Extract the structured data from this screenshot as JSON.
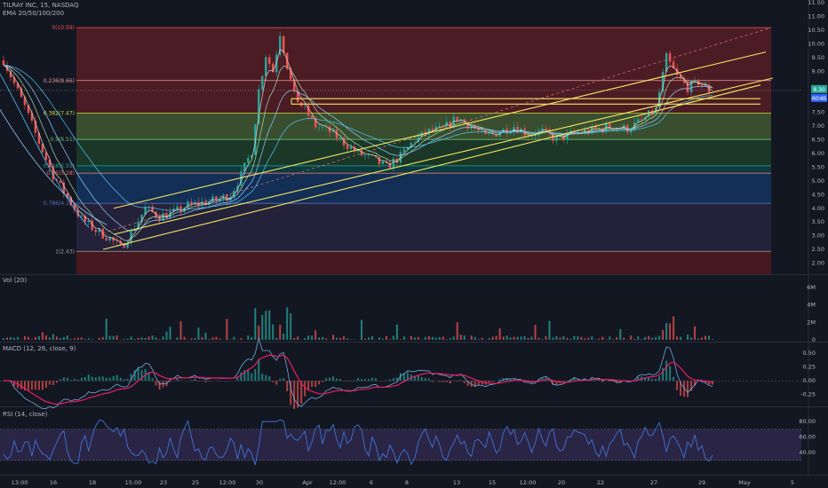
{
  "header": {
    "symbol": "TILRAY INC, 15, NASDAQ",
    "indicator": "EMA 20/50/100/200"
  },
  "panes": {
    "vol_label": "Vol (20)",
    "macd_label": "MACD (12, 26, close, 9)",
    "rsi_label": "RSI (14, close)"
  },
  "colors": {
    "background": "#131722",
    "candle_up": "#26a69a",
    "candle_down": "#ef5350",
    "channel": "#f5e663",
    "macd_line": "#6fa8dc",
    "signal_line": "#e91e63",
    "rsi_line": "#3f74d6",
    "rsi_band": "#7e57c2"
  },
  "chart_data": [
    {
      "type": "candlestick",
      "title": "TILRAY INC, 15, NASDAQ",
      "ylim": [
        1.5,
        11.5
      ],
      "y_ticks": [
        "11.50",
        "11.00",
        "10.50",
        "10.00",
        "9.50",
        "9.00",
        "8.50",
        "8.00",
        "7.50",
        "7.00",
        "6.50",
        "6.00",
        "5.50",
        "5.00",
        "4.50",
        "4.00",
        "3.50",
        "3.00",
        "2.50",
        "2.00"
      ],
      "x_ticks": [
        "13:00",
        "16",
        "18",
        "15:00",
        "23",
        "25",
        "12:00",
        "30",
        "Apr",
        "12:00",
        "6",
        "8",
        "13",
        "15",
        "12:00",
        "20",
        "22",
        "27",
        "29",
        "May",
        "5"
      ],
      "price_label": "8.30",
      "countdown_label": "00:45",
      "close_path": [
        [
          0,
          9.4
        ],
        [
          6,
          7.7
        ],
        [
          10,
          6.4
        ],
        [
          14,
          5.2
        ],
        [
          18,
          4.4
        ],
        [
          22,
          3.6
        ],
        [
          26,
          3.2
        ],
        [
          30,
          2.9
        ],
        [
          33,
          2.55
        ],
        [
          36,
          3.1
        ],
        [
          40,
          4.0
        ],
        [
          44,
          3.7
        ],
        [
          48,
          3.85
        ],
        [
          52,
          4.1
        ],
        [
          56,
          4.2
        ],
        [
          60,
          4.3
        ],
        [
          64,
          4.5
        ],
        [
          67,
          5.2
        ],
        [
          70,
          6.1
        ],
        [
          72,
          8.3
        ],
        [
          74,
          9.6
        ],
        [
          76,
          9.0
        ],
        [
          78,
          10.4
        ],
        [
          80,
          9.2
        ],
        [
          82,
          8.1
        ],
        [
          85,
          7.6
        ],
        [
          88,
          7.0
        ],
        [
          92,
          6.8
        ],
        [
          96,
          6.4
        ],
        [
          100,
          6.0
        ],
        [
          104,
          5.8
        ],
        [
          108,
          5.5
        ],
        [
          112,
          5.9
        ],
        [
          116,
          6.5
        ],
        [
          120,
          6.8
        ],
        [
          124,
          6.9
        ],
        [
          128,
          7.3
        ],
        [
          132,
          7.0
        ],
        [
          136,
          6.6
        ],
        [
          140,
          6.8
        ],
        [
          144,
          7.0
        ],
        [
          148,
          6.7
        ],
        [
          152,
          6.8
        ],
        [
          156,
          6.5
        ],
        [
          160,
          6.7
        ],
        [
          164,
          6.8
        ],
        [
          168,
          6.9
        ],
        [
          172,
          7.0
        ],
        [
          176,
          6.9
        ],
        [
          180,
          7.2
        ],
        [
          184,
          7.6
        ],
        [
          187,
          9.5
        ],
        [
          190,
          8.8
        ],
        [
          193,
          8.4
        ],
        [
          196,
          8.6
        ],
        [
          199,
          8.3
        ],
        [
          200,
          8.3
        ]
      ],
      "fibonacci": {
        "levels": [
          {
            "label": "0(10.59)",
            "value": 10.59,
            "color": "#ef5350"
          },
          {
            "label": "0.236(8.66)",
            "value": 8.66,
            "color": "#ef9a9a"
          },
          {
            "label": "0.382(7.47)",
            "value": 7.47,
            "color": "#cddc39"
          },
          {
            "label": "0.5(6.51)",
            "value": 6.51,
            "color": "#66bb6a"
          },
          {
            "label": "0.618(5.55)",
            "value": 5.55,
            "color": "#26a69a"
          },
          {
            "label": "0.65(5.28)",
            "value": 5.28,
            "color": "#e57373"
          },
          {
            "label": "0.786(4.18)",
            "value": 4.18,
            "color": "#5c6bc0"
          },
          {
            "label": "1(2.43)",
            "value": 2.43,
            "color": "#9e9e9e"
          }
        ],
        "fills": [
          "#c62828",
          "#c62828",
          "#8bc34a",
          "#2e7d32",
          "#00897b",
          "#1565c0",
          "#4a3a6e",
          "#b71c1c",
          "#7b1fa2"
        ]
      }
    },
    {
      "type": "bar",
      "title": "Vol (20)",
      "y_ticks": [
        "6M",
        "4M",
        "2M",
        "0"
      ],
      "ylim": [
        0,
        7
      ]
    },
    {
      "type": "line",
      "title": "MACD (12, 26, close, 9)",
      "y_ticks": [
        "0.50",
        "0.25",
        "0.00",
        "-0.25"
      ],
      "ylim": [
        -0.4,
        0.6
      ]
    },
    {
      "type": "line",
      "title": "RSI (14, close)",
      "y_ticks": [
        "80.00",
        "60.00",
        "40.00"
      ],
      "ylim": [
        15,
        95
      ],
      "bands": [
        30,
        70
      ]
    }
  ]
}
